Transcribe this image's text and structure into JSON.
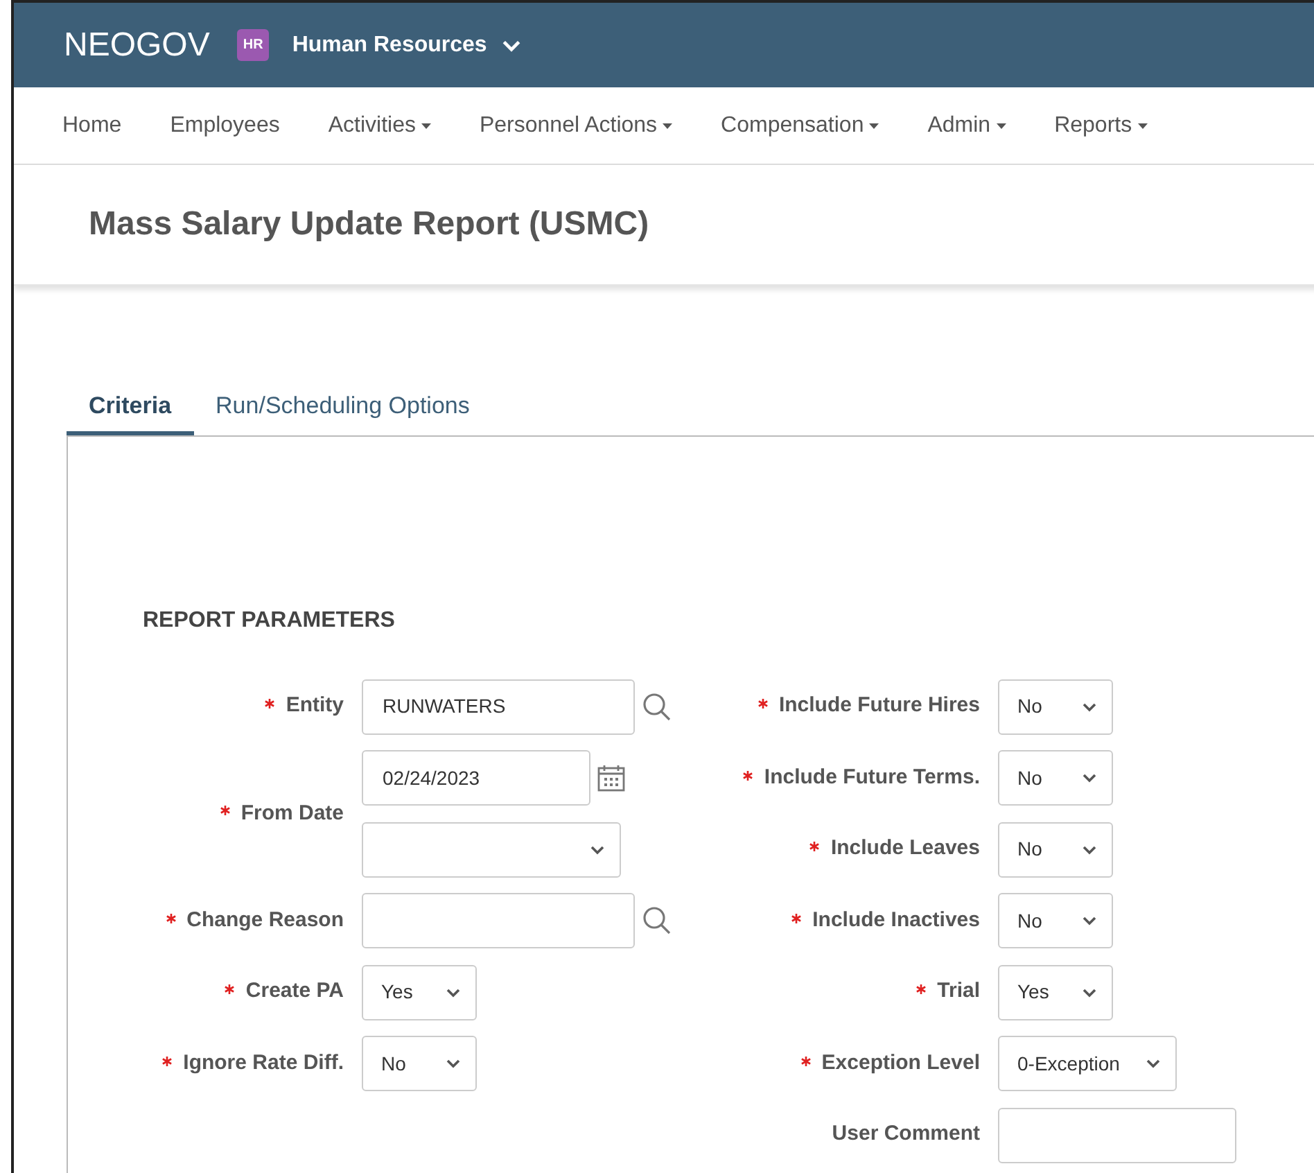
{
  "header": {
    "logo": "NEOGOV",
    "app_badge": "HR",
    "app_name": "Human Resources"
  },
  "nav": [
    {
      "label": "Home",
      "dropdown": false
    },
    {
      "label": "Employees",
      "dropdown": false
    },
    {
      "label": "Activities",
      "dropdown": true
    },
    {
      "label": "Personnel Actions",
      "dropdown": true
    },
    {
      "label": "Compensation",
      "dropdown": true
    },
    {
      "label": "Admin",
      "dropdown": true
    },
    {
      "label": "Reports",
      "dropdown": true
    }
  ],
  "page_title": "Mass Salary Update Report (USMC)",
  "tabs": [
    {
      "label": "Criteria",
      "selected": true
    },
    {
      "label": "Run/Scheduling Options",
      "selected": false
    }
  ],
  "section_title": "REPORT PARAMETERS",
  "left_fields": [
    {
      "kind": "lookup",
      "label": "Entity",
      "required": true,
      "value": "RUNWATERS"
    },
    {
      "kind": "date",
      "label": "From Date",
      "required": true,
      "value": "02/24/2023"
    },
    {
      "kind": "lookup",
      "label": "Change Reason",
      "required": true
    },
    {
      "kind": "select",
      "label": "Create PA",
      "required": true,
      "value": "Yes"
    },
    {
      "kind": "select",
      "label": "Ignore Rate Diff.",
      "required": true,
      "value": "No"
    }
  ],
  "right_fields": [
    {
      "kind": "select",
      "label": "Include Future Hires",
      "required": true,
      "value": "No"
    },
    {
      "kind": "select",
      "label": "Include Future Terms.",
      "required": true,
      "value": "No"
    },
    {
      "kind": "select",
      "label": "Include Leaves",
      "required": true,
      "value": "No"
    },
    {
      "kind": "select",
      "label": "Include Inactives",
      "required": true,
      "value": "No"
    },
    {
      "kind": "select",
      "label": "Trial",
      "required": true,
      "value": "Yes"
    },
    {
      "kind": "wide_select",
      "label": "Exception Level",
      "required": true,
      "value": "0-Exception"
    },
    {
      "kind": "text",
      "label": "User Comment",
      "required": false
    }
  ]
}
